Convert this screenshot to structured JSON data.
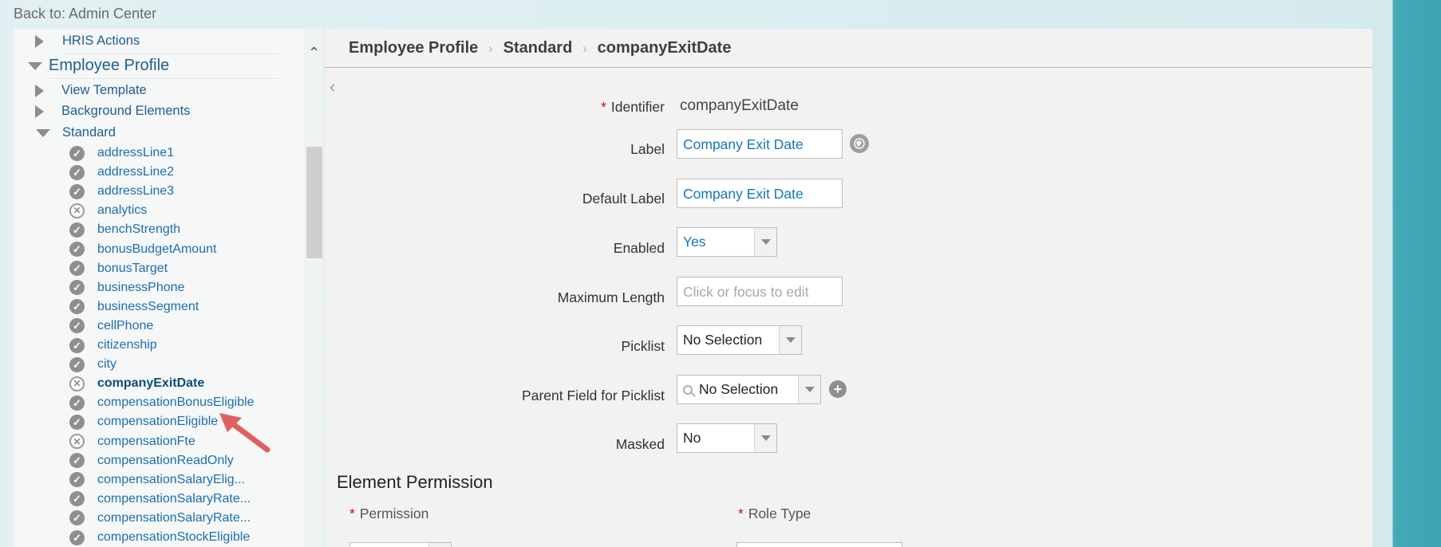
{
  "back_link": "Back to: Admin Center",
  "sidebar": {
    "hris_actions": "HRIS Actions",
    "employee_profile": "Employee Profile",
    "view_template": "View Template",
    "background_elements": "Background Elements",
    "standard": "Standard",
    "items": [
      {
        "label": "addressLine1",
        "status": "enabled"
      },
      {
        "label": "addressLine2",
        "status": "enabled"
      },
      {
        "label": "addressLine3",
        "status": "enabled"
      },
      {
        "label": "analytics",
        "status": "disabled"
      },
      {
        "label": "benchStrength",
        "status": "enabled"
      },
      {
        "label": "bonusBudgetAmount",
        "status": "enabled"
      },
      {
        "label": "bonusTarget",
        "status": "enabled"
      },
      {
        "label": "businessPhone",
        "status": "enabled"
      },
      {
        "label": "businessSegment",
        "status": "enabled"
      },
      {
        "label": "cellPhone",
        "status": "enabled"
      },
      {
        "label": "citizenship",
        "status": "enabled"
      },
      {
        "label": "city",
        "status": "enabled"
      },
      {
        "label": "companyExitDate",
        "status": "disabled",
        "selected": true
      },
      {
        "label": "compensationBonusEligible",
        "status": "enabled"
      },
      {
        "label": "compensationEligible",
        "status": "enabled"
      },
      {
        "label": "compensationFte",
        "status": "disabled"
      },
      {
        "label": "compensationReadOnly",
        "status": "enabled"
      },
      {
        "label": "compensationSalaryElig...",
        "status": "enabled"
      },
      {
        "label": "compensationSalaryRate...",
        "status": "enabled"
      },
      {
        "label": "compensationSalaryRate...",
        "status": "enabled"
      },
      {
        "label": "compensationStockEligible",
        "status": "enabled"
      }
    ]
  },
  "breadcrumb": [
    "Employee Profile",
    "Standard",
    "companyExitDate"
  ],
  "form": {
    "identifier_label": "Identifier",
    "identifier_value": "companyExitDate",
    "label_label": "Label",
    "label_value": "Company Exit Date",
    "default_label_label": "Default Label",
    "default_label_value": "Company Exit Date",
    "enabled_label": "Enabled",
    "enabled_value": "Yes",
    "max_length_label": "Maximum Length",
    "max_length_placeholder": "Click or focus to edit",
    "picklist_label": "Picklist",
    "picklist_value": "No Selection",
    "parent_field_label": "Parent Field for Picklist",
    "parent_field_value": "No Selection",
    "masked_label": "Masked",
    "masked_value": "No"
  },
  "element_permission": {
    "title": "Element Permission",
    "permission_label": "Permission",
    "role_type_label": "Role Type"
  },
  "colors": {
    "link": "#1a6fb0",
    "required": "#dd0000",
    "accent": "#3aa3b2"
  }
}
